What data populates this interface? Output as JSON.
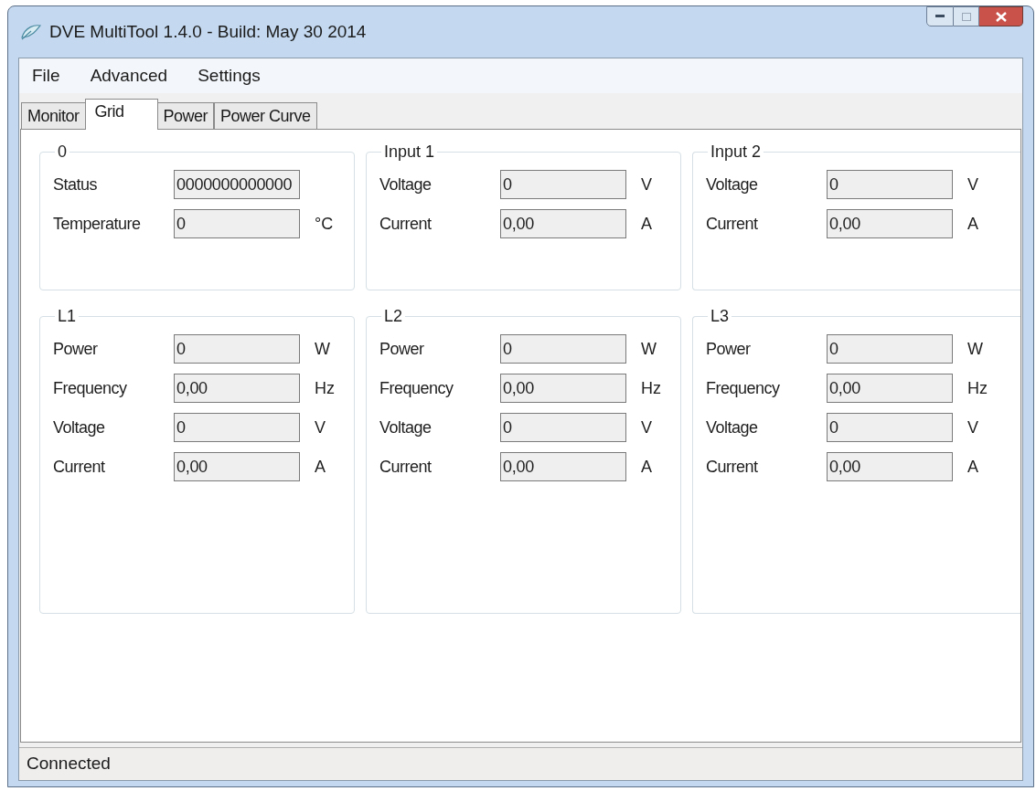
{
  "window": {
    "title": "DVE MultiTool 1.4.0 - Build: May 30 2014"
  },
  "menu": [
    "File",
    "Advanced",
    "Settings"
  ],
  "tabs": [
    {
      "label": "Monitor",
      "selected": false
    },
    {
      "label": "Grid",
      "selected": true
    },
    {
      "label": "Power",
      "selected": false
    },
    {
      "label": "Power Curve",
      "selected": false
    }
  ],
  "groups": [
    {
      "title": "0",
      "rows": [
        {
          "label": "Status",
          "value": "0000000000000"
        },
        {
          "label": "Temperature",
          "value": "0",
          "unit": "°C"
        }
      ]
    },
    {
      "title": "Input 1",
      "rows": [
        {
          "label": "Voltage",
          "value": "0",
          "unit": "V"
        },
        {
          "label": "Current",
          "value": "0,00",
          "unit": "A"
        }
      ]
    },
    {
      "title": "Input 2",
      "rows": [
        {
          "label": "Voltage",
          "value": "0",
          "unit": "V"
        },
        {
          "label": "Current",
          "value": "0,00",
          "unit": "A"
        }
      ]
    },
    {
      "title": "L1",
      "rows": [
        {
          "label": "Power",
          "value": "0",
          "unit": "W"
        },
        {
          "label": "Frequency",
          "value": "0,00",
          "unit": "Hz"
        },
        {
          "label": "Voltage",
          "value": "0",
          "unit": "V"
        },
        {
          "label": "Current",
          "value": "0,00",
          "unit": "A"
        }
      ]
    },
    {
      "title": "L2",
      "rows": [
        {
          "label": "Power",
          "value": "0",
          "unit": "W"
        },
        {
          "label": "Frequency",
          "value": "0,00",
          "unit": "Hz"
        },
        {
          "label": "Voltage",
          "value": "0",
          "unit": "V"
        },
        {
          "label": "Current",
          "value": "0,00",
          "unit": "A"
        }
      ]
    },
    {
      "title": "L3",
      "rows": [
        {
          "label": "Power",
          "value": "0",
          "unit": "W"
        },
        {
          "label": "Frequency",
          "value": "0,00",
          "unit": "Hz"
        },
        {
          "label": "Voltage",
          "value": "0",
          "unit": "V"
        },
        {
          "label": "Current",
          "value": "0,00",
          "unit": "A"
        }
      ]
    }
  ],
  "status_bar": "Connected"
}
